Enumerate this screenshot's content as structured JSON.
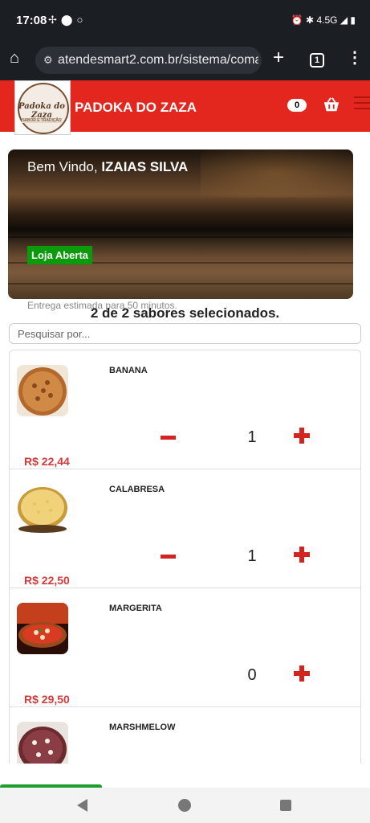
{
  "statusbar": {
    "time": "17:08",
    "network": "4.5G",
    "icons": [
      "fan-icon",
      "location-icon",
      "circle-icon",
      "alarm-icon",
      "bluetooth-icon",
      "signal-icon",
      "battery-icon"
    ]
  },
  "browser": {
    "url": "atendesmart2.com.br/sistema/comanda",
    "tab_count": "1"
  },
  "header": {
    "brand": "PADOKA DO ZAZA",
    "logo_text": "Padoka do Zaza",
    "logo_sub": "SABOR E TRADIÇÃO",
    "cart_count": "0"
  },
  "banner": {
    "welcome_prefix": "Bem Vindo,",
    "user_name": "IZAIAS SILVA",
    "store_status": "Loja Aberta"
  },
  "delivery_note": "Entrega estimada para 50 minutos.",
  "selection_note": "2 de 2 sabores selecionados.",
  "search": {
    "placeholder": "Pesquisar por..."
  },
  "products": [
    {
      "name": "BANANA",
      "quantity": "1",
      "price": "R$ 22,44"
    },
    {
      "name": "CALABRESA",
      "quantity": "1",
      "price": "R$ 22,50"
    },
    {
      "name": "MARGERITA",
      "quantity": "0",
      "price": "R$ 29,50"
    },
    {
      "name": "MARSHMELOW",
      "quantity": "",
      "price": ""
    }
  ],
  "colors": {
    "header_red": "#e3261e",
    "price_red": "#d33a3a",
    "open_green": "#0a9a0a"
  }
}
